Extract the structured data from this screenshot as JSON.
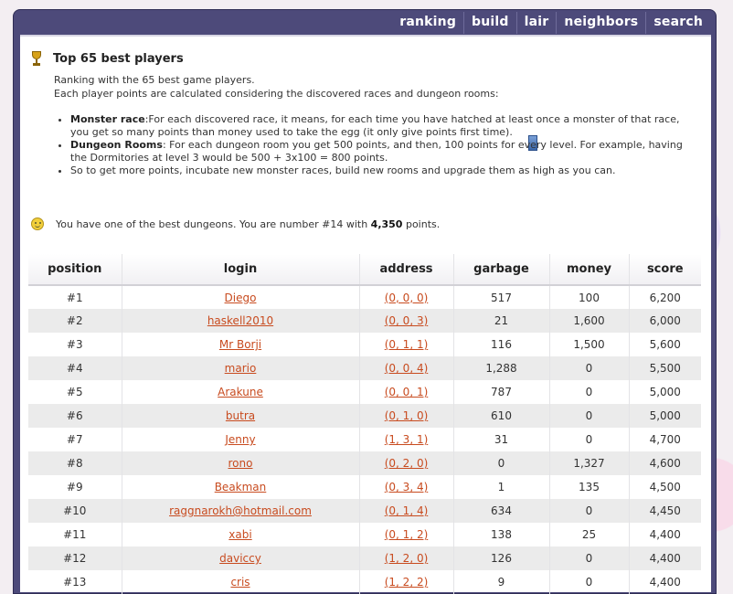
{
  "nav": [
    "ranking",
    "build",
    "lair",
    "neighbors",
    "search"
  ],
  "page": {
    "title": "Top 65 best players",
    "intro_line1": "Ranking with the 65 best game players.",
    "intro_line2": "Each player points are calculated considering the discovered races and dungeon rooms:",
    "rules": [
      {
        "label": "Monster race",
        "sep": ":",
        "text": "For each discovered race, it means, for each time you have hatched at least once a monster of that race, you get so many points than money used to take the egg (it only give points first time)."
      },
      {
        "label": "Dungeon Rooms",
        "sep": ": ",
        "text": "For each dungeon room you get 500 points, and then, 100 points for every level. For example, having the Dormitories at level 3 would be 500 + 3x100 = 800 points."
      },
      {
        "label": "",
        "sep": "",
        "text": "So to get more points, incubate new monster races, build new rooms and upgrade them as high as you can."
      }
    ],
    "status_pre": "You have one of the best dungeons. You are number #14 with",
    "status_points": "4,350",
    "status_post": "points."
  },
  "table": {
    "headers": [
      "position",
      "login",
      "address",
      "garbage",
      "money",
      "score"
    ],
    "rows": [
      [
        "#1",
        "Diego",
        "(0, 0, 0)",
        "517",
        "100",
        "6,200"
      ],
      [
        "#2",
        "haskell2010",
        "(0, 0, 3)",
        "21",
        "1,600",
        "6,000"
      ],
      [
        "#3",
        "Mr Borji",
        "(0, 1, 1)",
        "116",
        "1,500",
        "5,600"
      ],
      [
        "#4",
        "mario",
        "(0, 0, 4)",
        "1,288",
        "0",
        "5,500"
      ],
      [
        "#5",
        "Arakune",
        "(0, 0, 1)",
        "787",
        "0",
        "5,000"
      ],
      [
        "#6",
        "butra",
        "(0, 1, 0)",
        "610",
        "0",
        "5,000"
      ],
      [
        "#7",
        "Jenny",
        "(1, 3, 1)",
        "31",
        "0",
        "4,700"
      ],
      [
        "#8",
        "rono",
        "(0, 2, 0)",
        "0",
        "1,327",
        "4,600"
      ],
      [
        "#9",
        "Beakman",
        "(0, 3, 4)",
        "1",
        "135",
        "4,500"
      ],
      [
        "#10",
        "raggnarokh@hotmail.com",
        "(0, 1, 4)",
        "634",
        "0",
        "4,450"
      ],
      [
        "#11",
        "xabi",
        "(0, 1, 2)",
        "138",
        "25",
        "4,400"
      ],
      [
        "#12",
        "daviccy",
        "(1, 2, 0)",
        "126",
        "0",
        "4,400"
      ],
      [
        "#13",
        "cris",
        "(1, 2, 2)",
        "9",
        "0",
        "4,400"
      ]
    ]
  }
}
